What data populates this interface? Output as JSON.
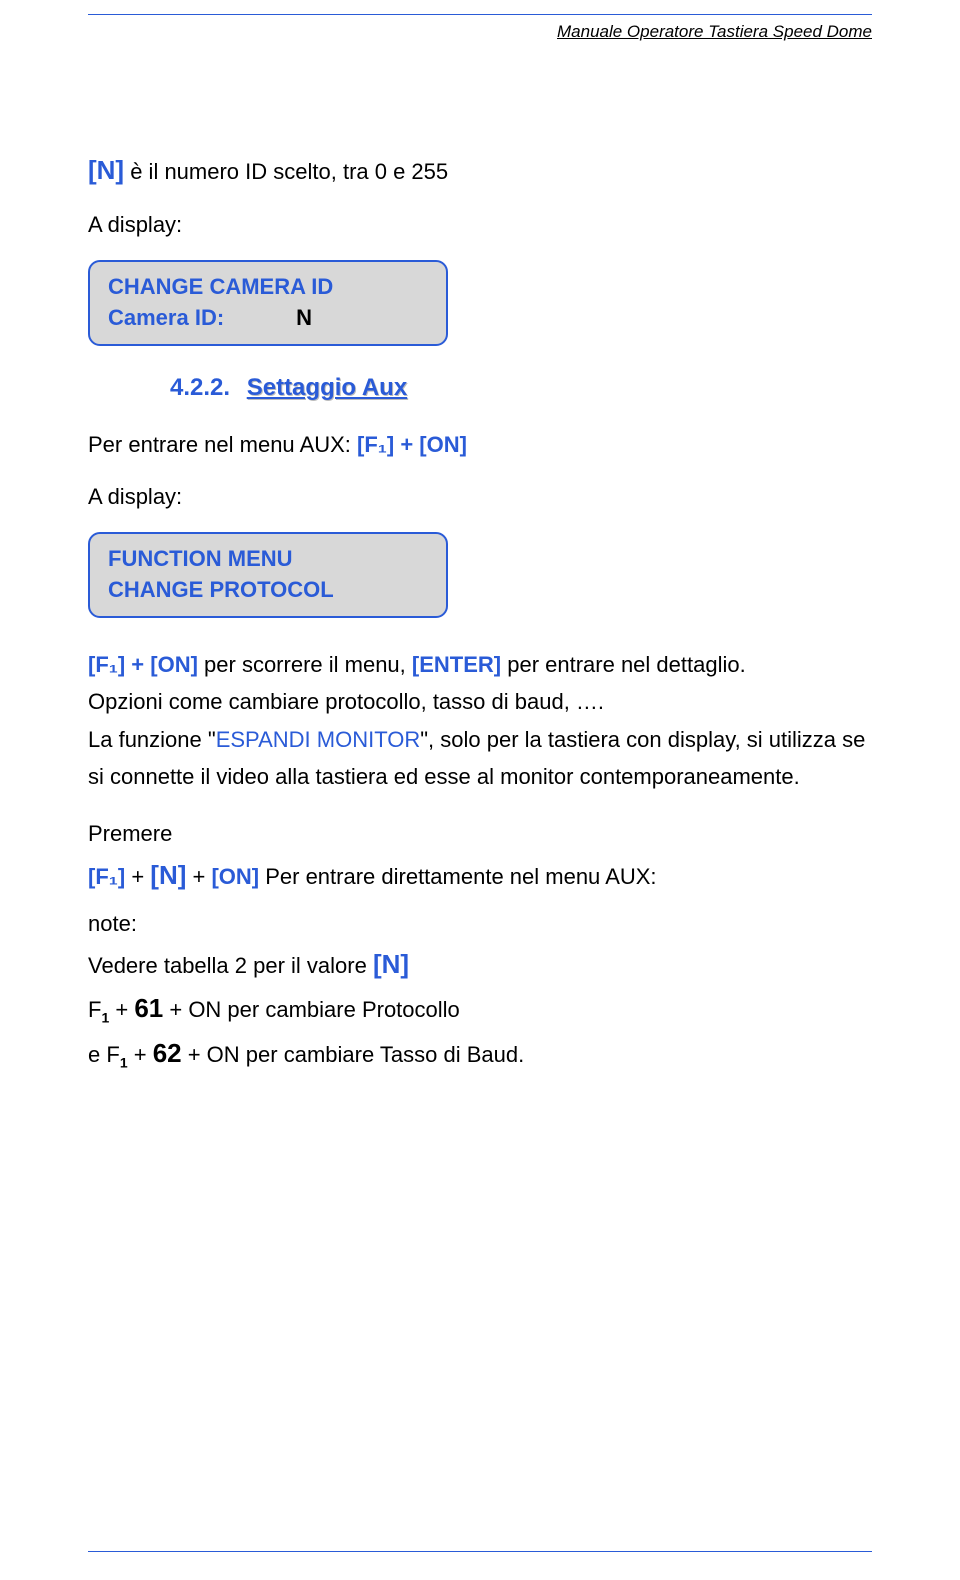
{
  "header": {
    "title": "Manuale Operatore Tastiera Speed Dome"
  },
  "intro": {
    "n_bracket": "[N]",
    "rest": " è il numero ID scelto, tra 0 e 255",
    "a_display": "A display:"
  },
  "box1": {
    "line1": "CHANGE CAMERA ID",
    "label": "Camera ID:",
    "value": "N"
  },
  "section": {
    "num": "4.2.2.",
    "title": "Settaggio Aux"
  },
  "aux": {
    "pre": "Per entrare nel menu AUX: ",
    "cmd": "[F₁] + [ON]",
    "a_display": "A display:"
  },
  "box2": {
    "line1": "FUNCTION MENU",
    "line2": "CHANGE PROTOCOL"
  },
  "after_box2": {
    "cmd1": "[F₁] + [ON]",
    "cmd1_rest": " per scorrere il menu, ",
    "enter": "[ENTER]",
    "cmd1_rest2": " per entrare nel dettaglio.",
    "line2": "Opzioni come cambiare protocollo, tasso di baud, ….",
    "line3a": "La funzione \"",
    "line3b": "ESPANDI MONITOR",
    "line3c": "\", solo per la tastiera con display, si utilizza se si connette il video alla tastiera ed esse al monitor contemporaneamente."
  },
  "premere": {
    "heading": "Premere",
    "l1a": "[F₁]",
    "l1plus": " + ",
    "l1n": "[N]",
    "l1plus2": " + ",
    "l1on": "[ON]",
    "l1rest": "  Per entrare direttamente nel menu AUX:",
    "note": "note:",
    "l2a": "Vedere tabella 2 per il valore ",
    "l2n": "[N]",
    "l3a": "F",
    "l3sub": "1",
    "l3plus": " + ",
    "l3num": "61",
    "l3rest": " + ON  per cambiare Protocollo",
    "l4pre": "e ",
    "l4a": "F",
    "l4sub": "1",
    "l4plus": " + ",
    "l4num": "62",
    "l4rest": " + ON per cambiare Tasso di Baud."
  }
}
